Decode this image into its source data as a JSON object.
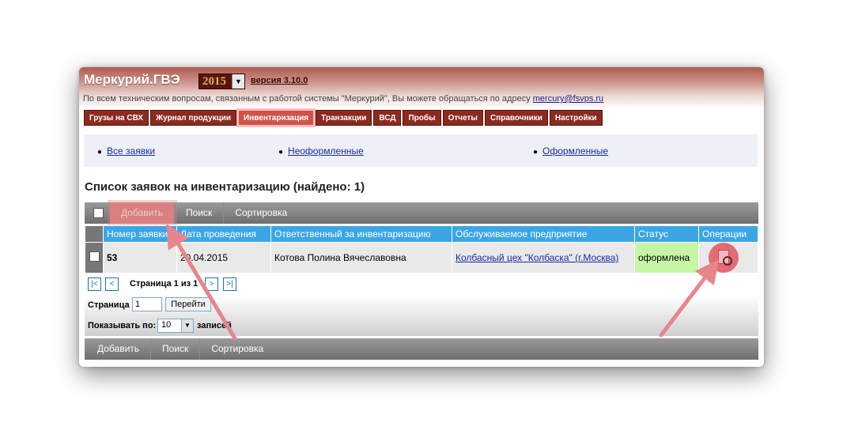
{
  "header": {
    "app_title": "Меркурий.ГВЭ",
    "year": "2015",
    "version": "версия 3.10.0",
    "support_text": "По всем техническим вопросам, связанным с работой системы \"Меркурий\", Вы можете обращаться по адресу",
    "support_email": "mercury@fsvps.ru"
  },
  "menu": {
    "items": [
      {
        "label": "Грузы на СВХ"
      },
      {
        "label": "Журнал продукции"
      },
      {
        "label": "Инвентаризация"
      },
      {
        "label": "Транзакции"
      },
      {
        "label": "ВСД"
      },
      {
        "label": "Пробы"
      },
      {
        "label": "Отчеты"
      },
      {
        "label": "Справочники"
      },
      {
        "label": "Настройки"
      }
    ],
    "active_index": 2
  },
  "filters": {
    "all": "Все заявки",
    "unregistered": "Неоформленные",
    "registered": "Оформленные"
  },
  "list": {
    "title": "Список заявок на инвентаризацию (найдено: 1)"
  },
  "toolbar": {
    "add": "Добавить",
    "search": "Поиск",
    "sort": "Сортировка"
  },
  "table": {
    "columns": [
      "Номер заявки",
      "Дата проведения",
      "Ответственный за инвентаризацию",
      "Обслуживаемое предприятие",
      "Статус",
      "Операции"
    ],
    "rows": [
      {
        "number": "53",
        "date": "20.04.2015",
        "responsible": "Котова Полина Вячеславовна",
        "enterprise": "Колбасный цех \"Колбаска\" (г.Москва)",
        "status": "оформлена"
      }
    ]
  },
  "pager": {
    "first": "|<",
    "prev": "<",
    "next": ">",
    "last": ">|",
    "info": "Страница 1 из 1",
    "page_label": "Страница",
    "page_value": "1",
    "go": "Перейти",
    "show_label": "Показывать по:",
    "per_page": "10",
    "records_label": "записей"
  },
  "colors": {
    "menu_bg": "#8c2a20",
    "header_blue": "#3ba6e6",
    "status_green": "#c7f5a6",
    "highlight": "#e26b74"
  }
}
